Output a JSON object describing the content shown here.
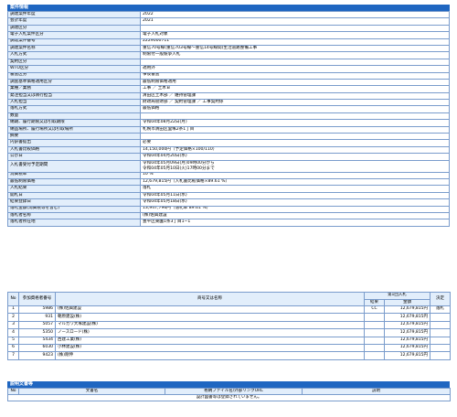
{
  "section1": {
    "title": "案件情報"
  },
  "info_rows": [
    {
      "label": "調達案件年度",
      "value": [
        "2022"
      ]
    },
    {
      "label": "会計年度",
      "value": [
        "2021"
      ]
    },
    {
      "label": "調達区分",
      "value": [
        ""
      ]
    },
    {
      "label": "電子入札案件区分",
      "value": [
        "電子入札対象"
      ]
    },
    {
      "label": "調達案件番号",
      "value": [
        "2229000711"
      ]
    },
    {
      "label": "調達案件名称",
      "value": [
        "重信70号線(重信703号線〜重信14号線間)生活道路整備工事"
      ]
    },
    {
      "label": "入札方式",
      "value": [
        "制限付一般競争入札"
      ]
    },
    {
      "label": "契約区分",
      "value": [
        ""
      ]
    },
    {
      "label": "WTO区分",
      "value": [
        "適用外"
      ]
    },
    {
      "label": "審査区分",
      "value": [
        "事後審査"
      ]
    },
    {
      "label": "調査基準価格適用区分",
      "value": [
        "最低制限価格適用"
      ]
    },
    {
      "label": "業種／業務",
      "value": [
        "工事 ／ 土木Ｂ"
      ]
    },
    {
      "label": "発注担当又は執行担当",
      "value": [
        "清田区土木部 ／ 維持管理課"
      ]
    },
    {
      "label": "入札担当",
      "value": [
        "財政局管財部 ／ 契約管理課 ／ 工事契約係"
      ]
    },
    {
      "label": "落札方式",
      "value": [
        "最低価格"
      ]
    },
    {
      "label": "数量",
      "value": [
        ""
      ]
    },
    {
      "label": "納期、履行期限又は引取期限",
      "value": [
        "令和04年08月22日(月)"
      ]
    },
    {
      "label": "納品場所、履行場所又は引取場所",
      "value": [
        "札幌市清田区里塚2条1丁目"
      ]
    },
    {
      "label": "摘要",
      "value": [
        ""
      ]
    },
    {
      "label": "内訳書提出",
      "value": [
        "必要"
      ]
    },
    {
      "label": "入札書比較価格",
      "value": [
        "14,150,000円（予定価格×100/110）"
      ]
    },
    {
      "label": "公示日",
      "value": [
        "令和04年04月20日(水)"
      ]
    },
    {
      "label": "入札書受付予定期間",
      "value": [
        "令和04年05月09日(月)09時00分から",
        "令和04年05月10日(火)17時00分まで"
      ]
    },
    {
      "label": "消費税率",
      "value": [
        "10 %"
      ]
    },
    {
      "label": "最低制限価格",
      "value": [
        "12,679,815円（入札書比較価格×89.61 %）"
      ]
    },
    {
      "label": "入札結果",
      "value": [
        "落札"
      ]
    },
    {
      "label": "開札日",
      "value": [
        "令和04年05月11日(水)"
      ]
    },
    {
      "label": "結果登録日",
      "value": [
        "令和04年05月18日(水)"
      ]
    },
    {
      "label": "落札金額(消費税等を含む)",
      "value": [
        "13,947,796円（落札率 89.61 %）"
      ]
    },
    {
      "label": "落札者名称",
      "value": [
        "(株)佐興建設"
      ]
    },
    {
      "label": "落札者所在地",
      "value": [
        "豊平区東園1条3丁目1−1"
      ]
    }
  ],
  "bid_header": {
    "no": "No",
    "code": "参加資格者番号",
    "name": "商号又は名称",
    "round": "第1回入札",
    "result": "結果",
    "amount": "金額",
    "decision": "決定"
  },
  "bid_rows": [
    {
      "no": "1",
      "code": "5986",
      "name": "(株)佐興建設",
      "result": "CC",
      "amount": "12,679,815円",
      "decision": "落札"
    },
    {
      "no": "2",
      "code": "931",
      "name": "朝原建設(株)",
      "result": "",
      "amount": "12,679,815円",
      "decision": ""
    },
    {
      "no": "3",
      "code": "5057",
      "name": "マルカワ大塚建設(株)",
      "result": "",
      "amount": "12,679,815円",
      "decision": ""
    },
    {
      "no": "4",
      "code": "5350",
      "name": "ノースロード(株)",
      "result": "",
      "amount": "12,679,815円",
      "decision": ""
    },
    {
      "no": "5",
      "code": "5434",
      "name": "西建工業(株)",
      "result": "",
      "amount": "12,679,815円",
      "decision": ""
    },
    {
      "no": "6",
      "code": "6030",
      "name": "小林建設(株)",
      "result": "",
      "amount": "12,679,815円",
      "decision": ""
    },
    {
      "no": "7",
      "code": "9423",
      "name": "(株)剛伸",
      "result": "",
      "amount": "12,679,815円",
      "decision": ""
    }
  ],
  "section2": {
    "title": "説明文書等"
  },
  "doc_header": {
    "no": "No",
    "name": "文書名",
    "link": "格納ファイル名/外部リンクURL",
    "desc": "説明"
  },
  "doc_empty": "設計図書等は登録されていません。"
}
